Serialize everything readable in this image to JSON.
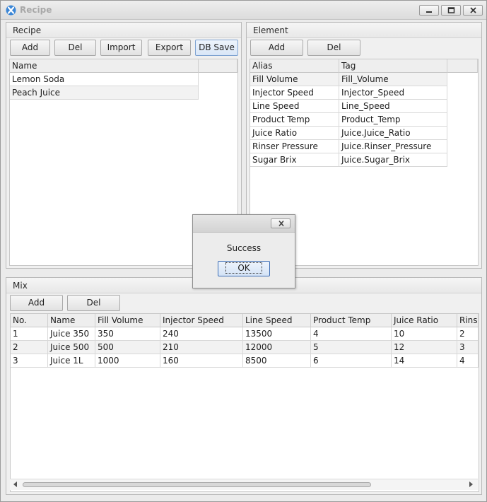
{
  "window": {
    "title": "Recipe"
  },
  "recipe": {
    "title": "Recipe",
    "buttons": {
      "add": "Add",
      "del": "Del",
      "import": "Import",
      "export": "Export",
      "db_save": "DB Save"
    },
    "columns": [
      "Name"
    ],
    "rows": [
      [
        "Lemon Soda"
      ],
      [
        "Peach Juice"
      ]
    ]
  },
  "element": {
    "title": "Element",
    "buttons": {
      "add": "Add",
      "del": "Del"
    },
    "columns": [
      "Alias",
      "Tag"
    ],
    "rows": [
      [
        "Fill Volume",
        "Fill_Volume"
      ],
      [
        "Injector Speed",
        "Injector_Speed"
      ],
      [
        "Line Speed",
        "Line_Speed"
      ],
      [
        "Product Temp",
        "Product_Temp"
      ],
      [
        "Juice Ratio",
        "Juice.Juice_Ratio"
      ],
      [
        "Rinser Pressure",
        "Juice.Rinser_Pressure"
      ],
      [
        "Sugar Brix",
        "Juice.Sugar_Brix"
      ]
    ]
  },
  "mix": {
    "title": "Mix",
    "buttons": {
      "add": "Add",
      "del": "Del"
    },
    "columns": [
      "No.",
      "Name",
      "Fill Volume",
      "Injector Speed",
      "Line Speed",
      "Product Temp",
      "Juice Ratio",
      "Rinser"
    ],
    "rows": [
      [
        "1",
        "Juice 350",
        "350",
        "240",
        "13500",
        "4",
        "10",
        "2"
      ],
      [
        "2",
        "Juice 500",
        "500",
        "210",
        "12000",
        "5",
        "12",
        "3"
      ],
      [
        "3",
        "Juice 1L",
        "1000",
        "160",
        "8500",
        "6",
        "14",
        "4"
      ]
    ]
  },
  "dialog": {
    "message": "Success",
    "ok": "OK"
  },
  "icons": {
    "app": "app-logo-icon",
    "minimize": "minimize-icon",
    "maximize": "maximize-icon",
    "close": "close-icon",
    "scroll_left": "scroll-left-arrow-icon",
    "scroll_right": "scroll-right-arrow-icon"
  }
}
